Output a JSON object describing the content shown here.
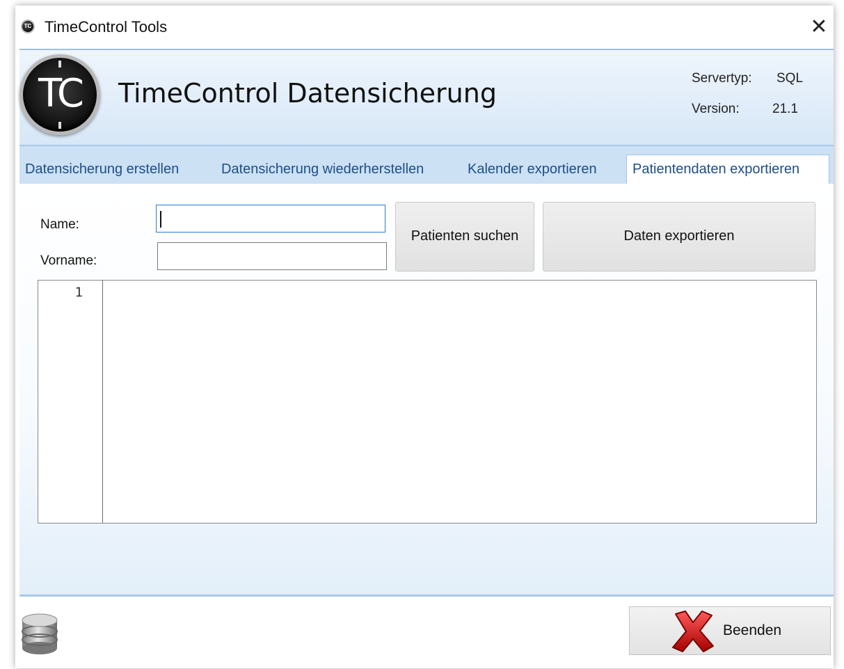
{
  "window": {
    "title": "TimeControl Tools",
    "icon_text": "TC"
  },
  "header": {
    "logo_text": "TC",
    "title": "TimeControl Datensicherung",
    "server_label": "Servertyp:",
    "server_value": "SQL",
    "version_label": "Version:",
    "version_value": "21.1"
  },
  "tabs": [
    {
      "label": "Datensicherung erstellen",
      "active": false
    },
    {
      "label": "Datensicherung wiederherstellen",
      "active": false
    },
    {
      "label": "Kalender exportieren",
      "active": false
    },
    {
      "label": "Patientendaten exportieren",
      "active": true
    }
  ],
  "form": {
    "name_label": "Name:",
    "name_value": "",
    "vorname_label": "Vorname:",
    "vorname_value": "",
    "search_button": "Patienten suchen",
    "export_button": "Daten exportieren"
  },
  "editor": {
    "line_numbers": [
      "1"
    ]
  },
  "footer": {
    "quit_button": "Beenden"
  },
  "colors": {
    "accent": "#1c4e88",
    "header_border": "#9fc0e3",
    "tab_bar": "#cde1f5"
  },
  "icons": [
    "app-icon",
    "close-icon",
    "database-icon",
    "red-x-icon"
  ]
}
